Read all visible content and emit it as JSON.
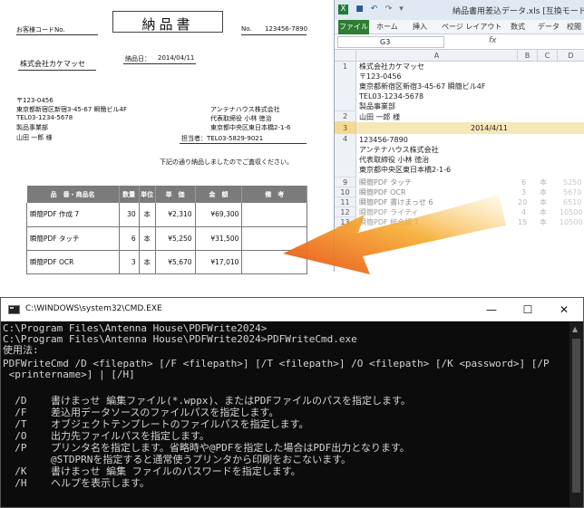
{
  "invoice": {
    "customer_code_label": "お客様コードNo.",
    "title": "納品書",
    "no_label": "No.",
    "no_value": "123456-7890",
    "delivery_date_label": "納品日：",
    "delivery_date_value": "2014/04/11",
    "customer_company": "株式会社カケマッセ",
    "customer_postal": "〒123-0456",
    "customer_address": "東京都新宿区新宿3-45-67 瞬簡ビル4F",
    "customer_tel": "TEL03-1234-5678",
    "customer_dept": "製品事業部",
    "customer_person": "山田 一郎 様",
    "sender_company": "アンテナハウス株式会社",
    "sender_rep": "代表取締役 小林 徳治",
    "sender_address": "東京都中央区東日本橋2-1-6",
    "staff_label": "担当者：TEL03-5829-9021",
    "delivery_note": "下記の通り納品しましたのでご査収ください。",
    "table_headers": [
      "品　番・商品名",
      "数量",
      "単位",
      "単　価",
      "金　額",
      "備　考"
    ],
    "rows": [
      {
        "name": "瞬簡PDF 作成 7",
        "qty": "30",
        "unit": "本",
        "price": "¥2,310",
        "amount": "¥69,300"
      },
      {
        "name": "瞬簡PDF タッチ",
        "qty": "6",
        "unit": "本",
        "price": "¥5,250",
        "amount": "¥31,500"
      },
      {
        "name": "瞬簡PDF OCR",
        "qty": "3",
        "unit": "本",
        "price": "¥5,670",
        "amount": "¥17,010"
      }
    ]
  },
  "excel": {
    "title": "納品書用差込データ.xls [互換モード",
    "tabs": [
      "ファイル",
      "ホーム",
      "挿入",
      "ページ レイアウト",
      "数式",
      "データ",
      "校閲"
    ],
    "name_box": "G3",
    "fx_label": "fx",
    "columns": [
      "A",
      "B",
      "C",
      "D"
    ],
    "row_numbers": [
      "1",
      "2",
      "3",
      "4",
      "9",
      "10",
      "11",
      "12",
      "13"
    ],
    "rows": [
      {
        "lines": [
          "株式会社カケマッセ",
          "〒123-0456",
          "東京都新宿区新宿3-45-67 瞬簡ビル4F",
          "TEL03-1234-5678",
          "製品事業部"
        ]
      },
      {
        "lines": [
          "山田 一郎 様"
        ]
      },
      {
        "lines": [
          "2014/4/11"
        ]
      },
      {
        "lines": [
          "123456-7890",
          "アンテナハウス株式会社",
          "代表取締役 小林 徳治",
          "東京都中央区東日本橋2-1-6"
        ]
      },
      {
        "lines": [
          "瞬簡PDF タッチ"
        ]
      },
      {
        "lines": [
          "瞬簡PDF OCR"
        ]
      },
      {
        "lines": [
          "瞬簡PDF 書けまっせ 6"
        ]
      },
      {
        "lines": [
          "瞬簡PDF ライティ"
        ]
      },
      {
        "lines": [
          "瞬簡PDF 統合版 7"
        ]
      }
    ],
    "right_values": [
      [
        "6",
        "本",
        "5250"
      ],
      [
        "3",
        "本",
        "5670"
      ],
      [
        "20",
        "本",
        "6510"
      ],
      [
        "4",
        "本",
        "10500"
      ],
      [
        "15",
        "本",
        "10500"
      ]
    ]
  },
  "cmd": {
    "title": "C:\\WINDOWS\\system32\\CMD.EXE",
    "minimize": "—",
    "maximize": "☐",
    "close": "✕",
    "lines": [
      "C:\\Program Files\\Antenna House\\PDFWrite2024>",
      "C:\\Program Files\\Antenna House\\PDFWrite2024>PDFWriteCmd.exe",
      "使用法:",
      "PDFWriteCmd /D <filepath> [/F <filepath>] [/T <filepath>] /O <filepath> [/K <password>] [/P",
      " <printername>] | [/H]",
      "",
      "  /D    書けまっせ 編集ファイル(*.wppx)、またはPDFファイルのパスを指定します。",
      "  /F    差込用データソースのファイルパスを指定します。",
      "  /T    オブジェクトテンプレートのファイルパスを指定します。",
      "  /O    出力先ファイルパスを指定します。",
      "  /P    プリンタ名を指定します。省略時や@PDFを指定した場合はPDF出力となります。",
      "        @STDPRNを指定すると通常使うプリンタから印刷をおこないます。",
      "  /K    書けまっせ 編集 ファイルのパスワードを指定します。",
      "  /H    ヘルプを表示します。"
    ]
  },
  "colors": {
    "excel_file_tab": "#2e7d32",
    "selected_row": "#f6e7b8",
    "arrow_start": "#f5a623",
    "arrow_end": "#e8531c",
    "table_header": "#7b7b7b",
    "cmd_background": "#0c0c0c"
  }
}
